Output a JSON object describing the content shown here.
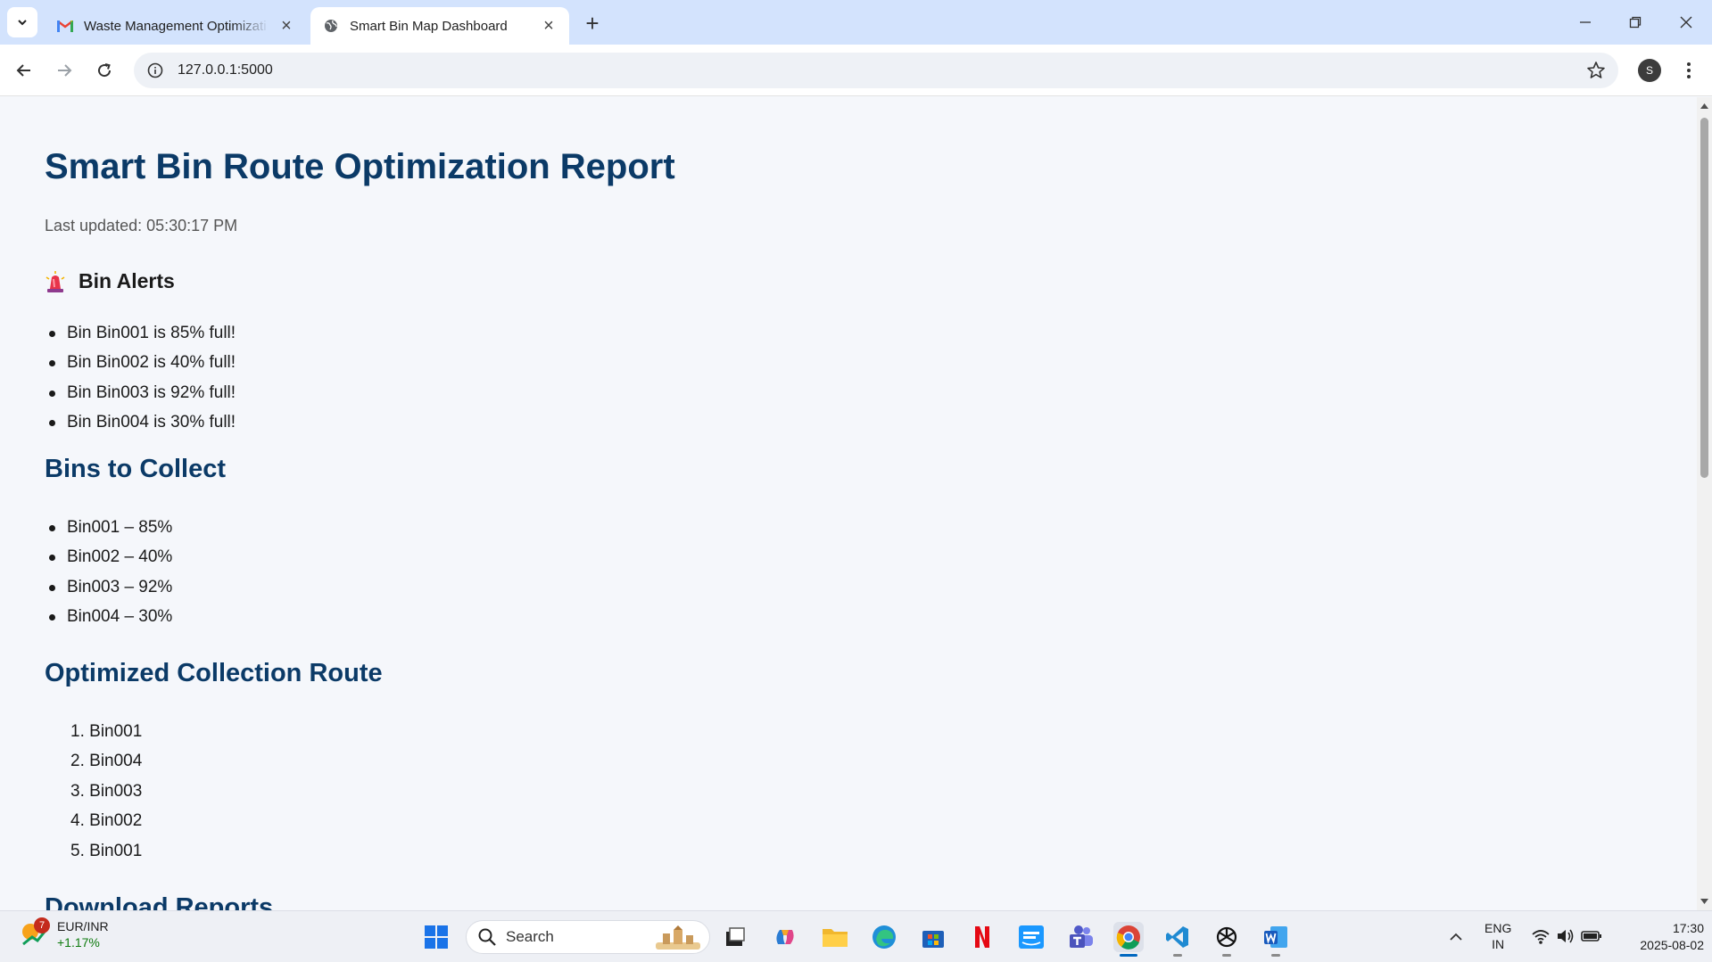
{
  "browser": {
    "tabs": [
      {
        "title": "Waste Management Optimizati",
        "favicon": "gmail-icon",
        "active": false
      },
      {
        "title": "Smart Bin Map Dashboard",
        "favicon": "globe-icon",
        "active": true
      }
    ],
    "url": "127.0.0.1:5000",
    "profile_initial": "S"
  },
  "page": {
    "title": "Smart Bin Route Optimization Report",
    "last_updated": "Last updated: 05:30:17 PM",
    "alerts_heading": "Bin Alerts",
    "alerts_icon": "siren-icon",
    "alerts": [
      "Bin Bin001 is 85% full!",
      "Bin Bin002 is 40% full!",
      "Bin Bin003 is 92% full!",
      "Bin Bin004 is 30% full!"
    ],
    "collect_heading": "Bins to Collect",
    "collect": [
      "Bin001 – 85%",
      "Bin002 – 40%",
      "Bin003 – 92%",
      "Bin004 – 30%"
    ],
    "route_heading": "Optimized Collection Route",
    "route": [
      {
        "num": "1.",
        "bin": "Bin001"
      },
      {
        "num": "2.",
        "bin": "Bin004"
      },
      {
        "num": "3.",
        "bin": "Bin003"
      },
      {
        "num": "4.",
        "bin": "Bin002"
      },
      {
        "num": "5.",
        "bin": "Bin001"
      }
    ],
    "download_heading": "Download Reports"
  },
  "taskbar": {
    "widget_badge": "7",
    "widget_pair": "EUR/INR",
    "widget_change": "+1.17%",
    "search_placeholder": "Search",
    "language_line1": "ENG",
    "language_line2": "IN",
    "time": "17:30",
    "date": "2025-08-02"
  },
  "colors": {
    "heading": "#0b3a67",
    "tab_strip": "#d3e3fd",
    "page_bg": "#f5f7fb"
  }
}
